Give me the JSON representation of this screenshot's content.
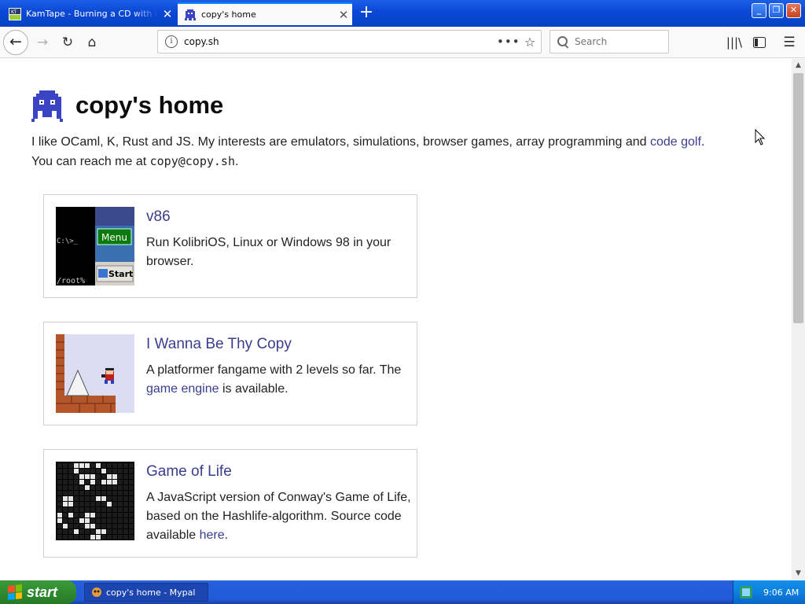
{
  "browser": {
    "tabs": [
      {
        "title": "KamTape - Burning a CD with iTunes",
        "active": false
      },
      {
        "title": "copy's home",
        "active": true
      }
    ],
    "url": "copy.sh",
    "search_placeholder": "Search",
    "colors": {
      "title_bar": "#0a48d6",
      "accent": "#0a84ff",
      "link": "#3a3d8f"
    }
  },
  "page": {
    "title": "copy's home",
    "intro": {
      "line1_text": "I like OCaml, K, Rust and JS. My interests are emulators, simulations, browser games, array programming and ",
      "line1_link": "code golf",
      "line1_end": ".",
      "line2_text": "You can reach me at ",
      "email": "copy@copy.sh",
      "line2_end": "."
    },
    "projects": [
      {
        "title": "v86",
        "description": "Run KolibriOS, Linux or Windows 98 in your browser.",
        "thumb": {
          "prompt": "C:\\>_",
          "root": "/root%",
          "menu": "Menu",
          "start": "Start"
        }
      },
      {
        "title": "I Wanna Be Thy Copy",
        "description_before": "A platformer fangame with 2 levels so far. The ",
        "description_link": "game engine",
        "description_after": " is available."
      },
      {
        "title": "Game of Life",
        "description_before": "A JavaScript version of Conway's Game of Life, based on the Hashlife-algorithm. Source code available ",
        "description_link": "here",
        "description_after": "."
      }
    ]
  },
  "taskbar": {
    "start_label": "start",
    "window_item": "copy's home - Mypal",
    "clock": "9:06 AM"
  }
}
